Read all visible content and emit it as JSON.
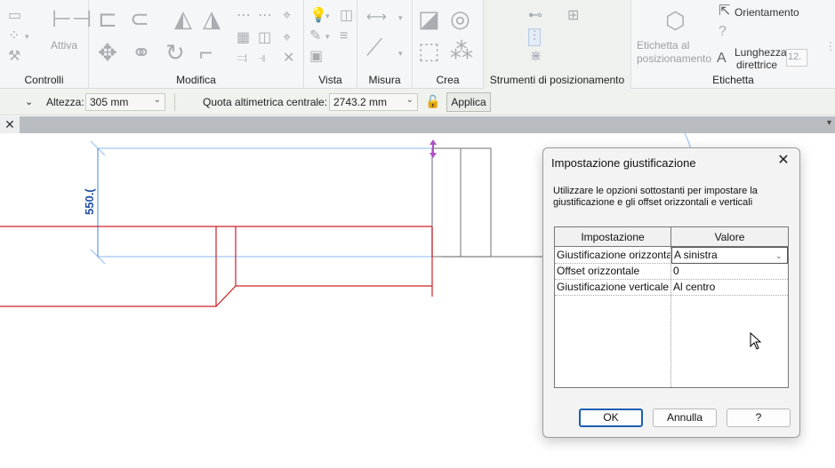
{
  "ribbon": {
    "panels": {
      "controlli": "Controlli",
      "modifica": "Modifica",
      "vista": "Vista",
      "misura": "Misura",
      "crea": "Crea",
      "strumenti": "Strumenti di posizionamento",
      "etichetta": "Etichetta"
    },
    "attiva_label": "Attiva",
    "orientamento_label": "Orientamento",
    "etichetta_pos_label_1": "Etichetta al",
    "etichetta_pos_label_2": "posizionamento",
    "lunghezza_label_1": "Lunghezza",
    "lunghezza_label_2": "direttrice",
    "lunghezza_value": "12."
  },
  "options_bar": {
    "altezza_label": "Altezza:",
    "altezza_value": "305 mm",
    "quota_label": "Quota altimetrica centrale:",
    "quota_value": "2743.2 mm",
    "applica_label": "Applica"
  },
  "canvas": {
    "dimension_text": "550.("
  },
  "dialog": {
    "title": "Impostazione giustificazione",
    "description": "Utilizzare le opzioni sottostanti per impostare la giustificazione e gli offset orizzontali e verticali",
    "columns": [
      "Impostazione",
      "Valore"
    ],
    "rows": [
      {
        "setting": "Giustificazione orizzonta",
        "value": "A sinistra"
      },
      {
        "setting": "Offset orizzontale",
        "value": "0"
      },
      {
        "setting": "Giustificazione verticale",
        "value": "Al centro"
      }
    ],
    "ok_label": "OK",
    "cancel_label": "Annulla",
    "help_label": "?"
  },
  "colors": {
    "accent_blue": "#1f4fa6",
    "wall_red": "#cc2027",
    "selection_blue": "#9ec3f2"
  }
}
